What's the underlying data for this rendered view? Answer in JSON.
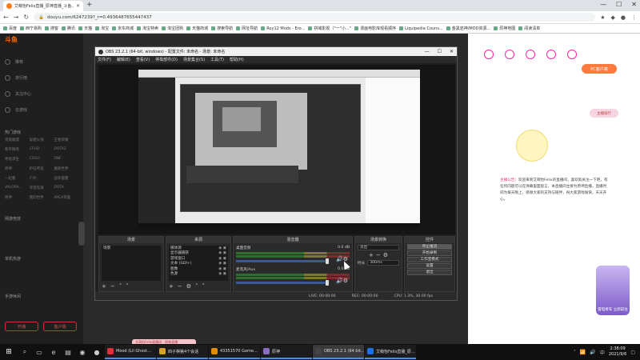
{
  "browser": {
    "tab_title": "艾萌怡Felix直播_原神直播_斗鱼...",
    "url": "douyu.com/6247239?_r=0.4936487655447437",
    "bookmarks": [
      "百度",
      "西宁易购",
      "搜客",
      "腾讯",
      "天猫",
      "淘宝",
      "京东商城",
      "淘宝特卖",
      "淘宝团购",
      "天猫商城",
      "搜索导航",
      "网址导航",
      "Roy12 Mods - Ero...",
      "拼域影视（\"一\"小...\"",
      "漫画电影库观看顺序",
      "Liquipedia Couns...",
      "金黑岩神/MOD资源...",
      "原神地图",
      "阅读清单"
    ]
  },
  "douyu": {
    "logo": "斗鱼",
    "sidebar_items": [
      "推荐",
      "排行榜",
      "关注中心",
      "云游戏"
    ],
    "categories": [
      "英雄联盟",
      "穿越火线",
      "王者荣耀",
      "和平精英",
      "CFHD",
      "DOTA2",
      "绝地求生",
      "CSGO",
      "DNF",
      "原神",
      "炉石传说",
      "魔兽世界",
      "一起看",
      "户外",
      "战争雷霆",
      "VALORA..",
      "守望先锋",
      "DOTA",
      "原神",
      "我的世界",
      "APEX英雄"
    ],
    "sections": [
      "热门游戏",
      "网游竞技",
      "单机热游",
      "手游休闲"
    ],
    "bottom_buttons": [
      "开播",
      "客户端"
    ],
    "pc_button": "PC客户端",
    "rank_button": "主播排行",
    "notice_label": "主播公告：",
    "notice_text": "欢迎来到艾萌怡Felix的直播间，喜欢就关注一下吧，有任何问题可以在弹幕里面留言，本直播间主要为原神直播，直播时间为每天晚上，感谢大家的支持与陪伴，祝大家游戏愉快，天天开心。",
    "ad_text": "雷电将军 立即前往",
    "toast": "艾萌怡Felix直播间 - 原神直播"
  },
  "obs": {
    "title": "OBS 23.2.1 (64-bit, windows) - 配置文件: 未命名 - 场景: 未命名",
    "menu": [
      "文件(F)",
      "编辑(E)",
      "查看(V)",
      "停靠部件(D)",
      "场景集合(S)",
      "工具(T)",
      "帮助(H)"
    ],
    "docks": {
      "scenes": {
        "title": "场景",
        "items": [
          "场景"
        ]
      },
      "sources": {
        "title": "来源",
        "items": [
          "媒体源",
          "显示器捕获",
          "游戏窗口",
          "文本 (GDI+)",
          "图像",
          "色源"
        ]
      },
      "mixer": {
        "title": "混音器",
        "channels": [
          {
            "name": "桌面音频",
            "db": "0.0 dB"
          },
          {
            "name": "麦克风/Aux",
            "db": "0.0 dB"
          }
        ]
      },
      "transitions": {
        "title": "场景转换",
        "type": "淡出",
        "duration_label": "时长",
        "duration": "300ms"
      },
      "controls": {
        "title": "控件",
        "buttons": [
          "停止推流",
          "开始录制",
          "工作室模式",
          "设置",
          "退出"
        ]
      }
    },
    "status": [
      "LIVE: 00:00:00",
      "REC: 00:00:00",
      "CPU: 1.3%, 30.00 fps"
    ]
  },
  "taskbar": {
    "apps": [
      {
        "label": "Mood (Lil Ghost...",
        "color": "#e0303a"
      },
      {
        "label": "四子棋第4个会话",
        "color": "#d7a12a"
      },
      {
        "label": "43351570 Game...",
        "color": "#e68a00"
      },
      {
        "label": "原神",
        "color": "#8c6bc9"
      },
      {
        "label": "OBS 23.2.1 (64 bit...",
        "color": "#444444"
      },
      {
        "label": "艾萌怡Felix直播_原...",
        "color": "#1a73e8"
      }
    ],
    "time": "2:38:09",
    "date": "2021/9/6"
  }
}
